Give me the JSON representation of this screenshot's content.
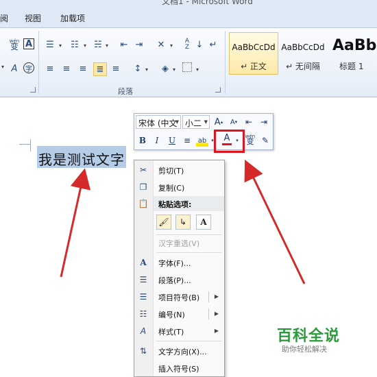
{
  "window": {
    "title": "文档1 - Microsoft Word"
  },
  "ribbon": {
    "tabs": [
      "阅",
      "视图",
      "加载项"
    ],
    "paragraph_group_label": "段落",
    "styles": [
      {
        "sample": "AaBbCcDd",
        "name": "↵ 正文",
        "active": true
      },
      {
        "sample": "AaBbCcDd",
        "name": "↵ 无间隔",
        "active": false
      },
      {
        "sample": "AaBb",
        "name": "标题 1",
        "active": false
      }
    ],
    "font_group_icons": {
      "phonetic": "wén",
      "phonetic_char": "变",
      "char_border": "A",
      "enclose_char": "字"
    }
  },
  "document": {
    "selected_text": "我是测试文字"
  },
  "mini_toolbar": {
    "font_name": "宋体 (中文",
    "font_size": "小二",
    "buttons": {
      "grow": "A",
      "shrink": "A",
      "bold": "B",
      "italic": "I",
      "underline": "U",
      "font_color": "A",
      "font_color_value": "#e0141e",
      "phonetic": "wén"
    }
  },
  "context_menu": {
    "items": {
      "cut": "剪切(T)",
      "copy": "复制(C)",
      "paste_header": "粘贴选项:",
      "reconvert": "汉字重选(V)",
      "font": "字体(F)...",
      "paragraph": "段落(P)...",
      "bullets": "项目符号(B)",
      "numbering": "编号(N)",
      "styles": "样式(T)",
      "text_direction": "文字方向(X)...",
      "insert_symbol": "插入符号(S)"
    },
    "paste_option_text": "A"
  },
  "watermark": {
    "title": "百科全说",
    "subtitle": "助你轻松解决"
  },
  "colors": {
    "highlight": "#e0141e",
    "arrow": "#d42a2a",
    "selection": "#b4cce8",
    "watermark": "#2a9a3a"
  }
}
